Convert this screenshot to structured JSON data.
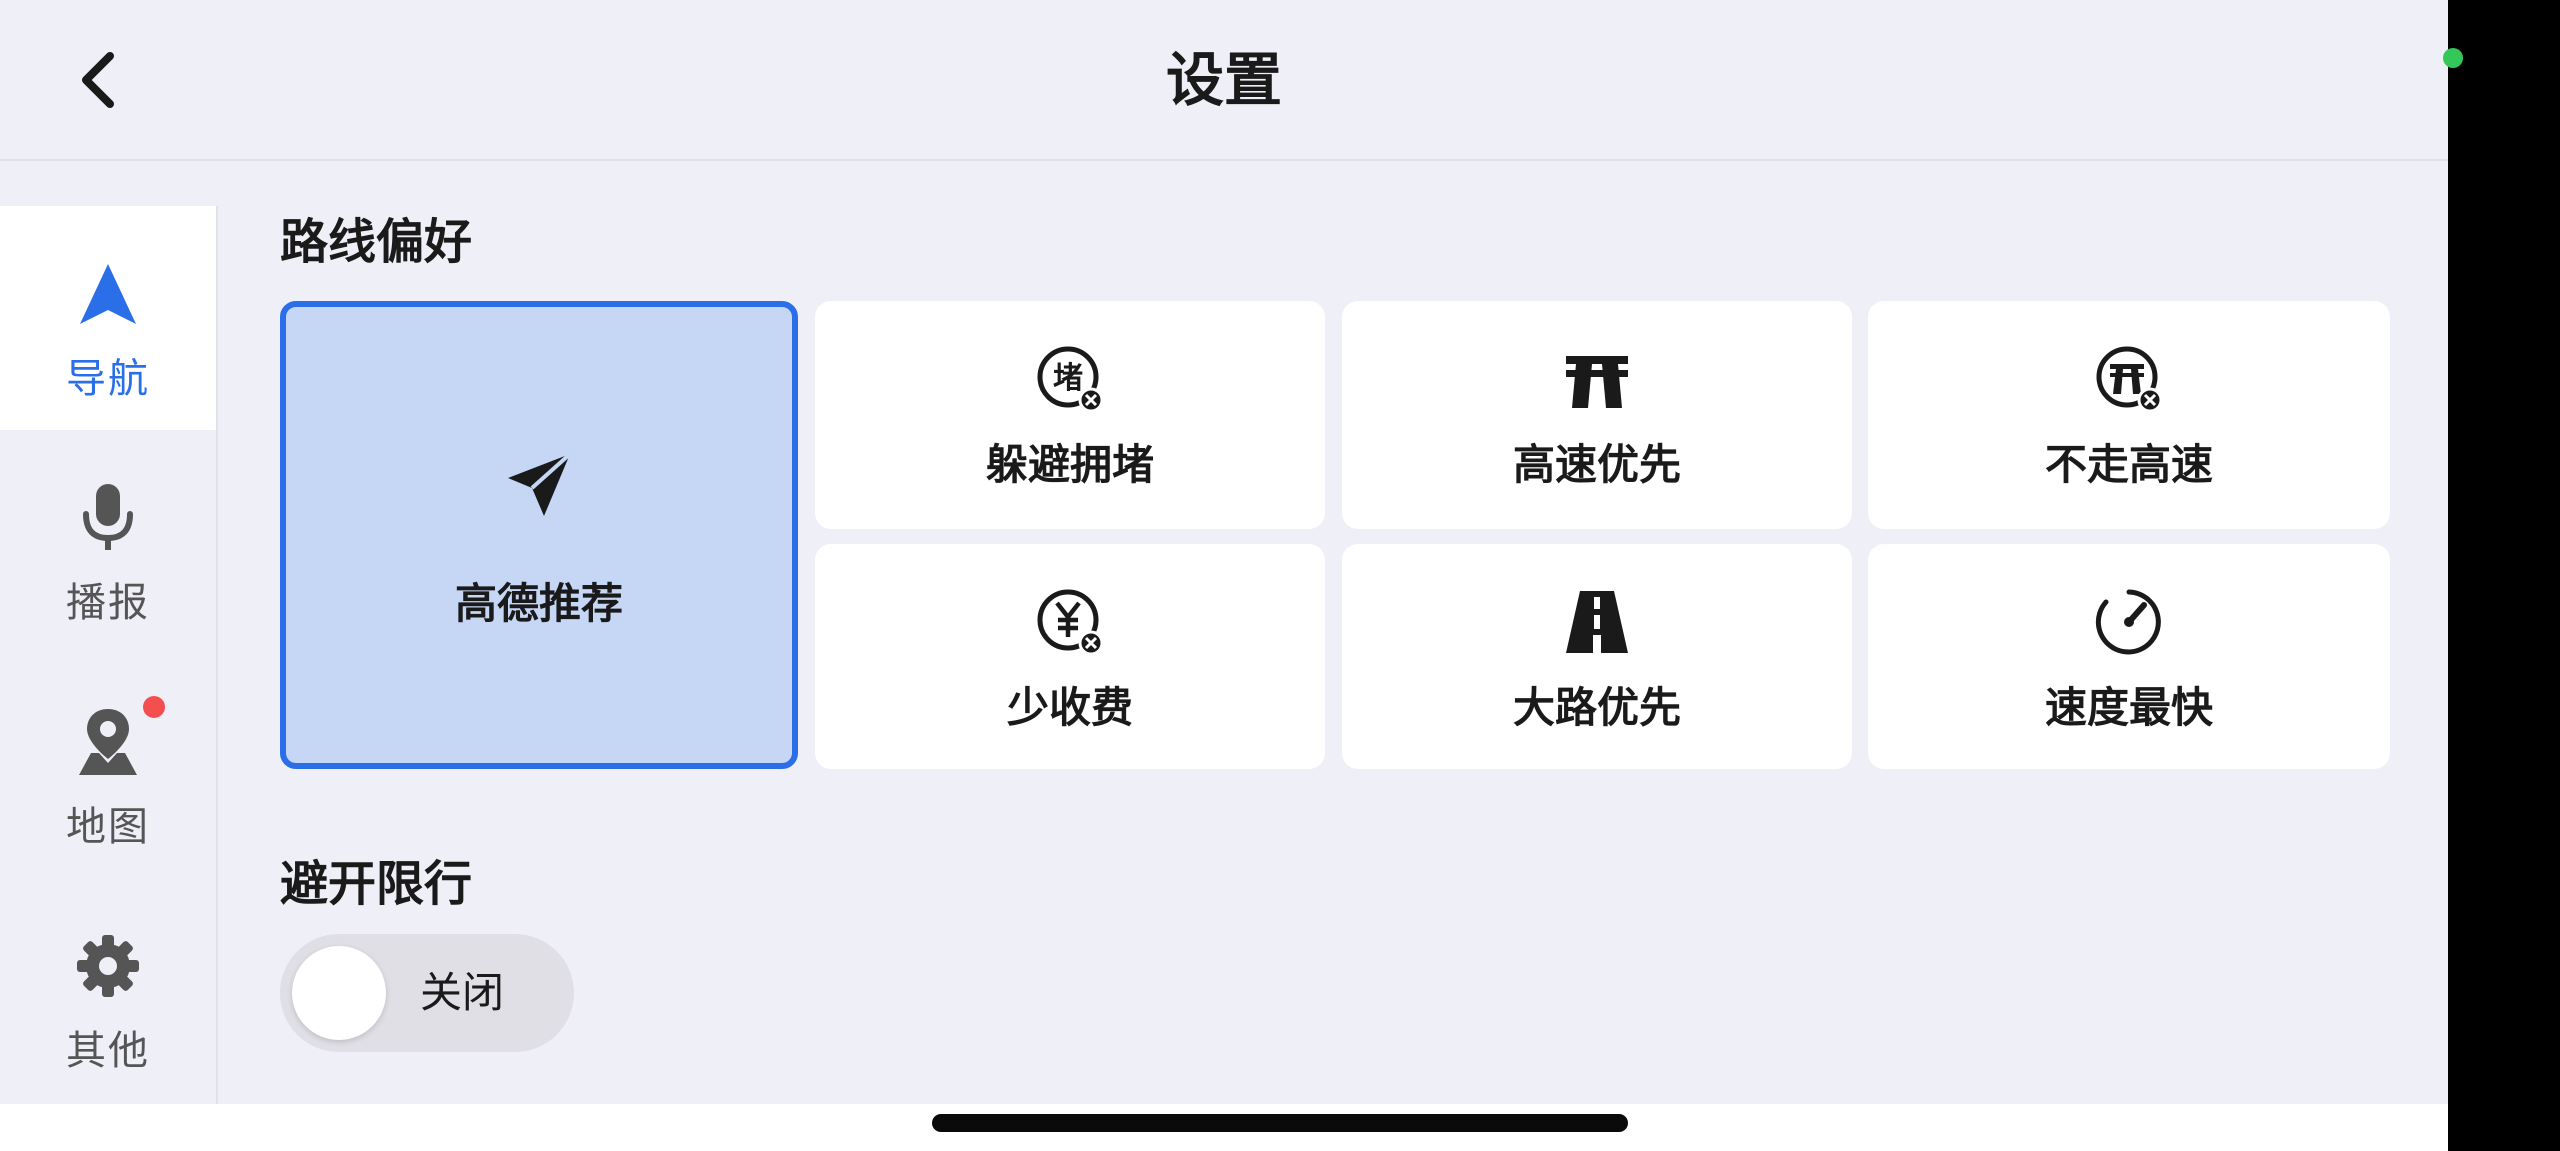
{
  "header": {
    "title": "设置",
    "back_icon": "chevron-left-icon"
  },
  "sidebar": {
    "items": [
      {
        "label": "导航",
        "icon": "navigation-arrow-icon",
        "active": true
      },
      {
        "label": "播报",
        "icon": "microphone-icon",
        "active": false
      },
      {
        "label": "地图",
        "icon": "map-pin-icon",
        "active": false,
        "badge": true
      },
      {
        "label": "其他",
        "icon": "gear-icon",
        "active": false
      }
    ]
  },
  "route_preference": {
    "title": "路线偏好",
    "options": [
      {
        "label": "高德推荐",
        "icon": "paper-plane-icon",
        "selected": true
      },
      {
        "label": "躲避拥堵",
        "icon": "avoid-congestion-icon",
        "selected": false
      },
      {
        "label": "高速优先",
        "icon": "highway-icon",
        "selected": false
      },
      {
        "label": "不走高速",
        "icon": "no-highway-icon",
        "selected": false
      },
      {
        "label": "少收费",
        "icon": "less-toll-icon",
        "selected": false
      },
      {
        "label": "大路优先",
        "icon": "main-road-icon",
        "selected": false
      },
      {
        "label": "速度最快",
        "icon": "speedometer-icon",
        "selected": false
      }
    ]
  },
  "restriction": {
    "title": "避开限行",
    "toggle_label": "关闭",
    "enabled": false
  },
  "colors": {
    "accent": "#2a6ee8",
    "selected_bg": "#c6d6f5",
    "background": "#efeff7",
    "badge": "#f44f4f"
  }
}
